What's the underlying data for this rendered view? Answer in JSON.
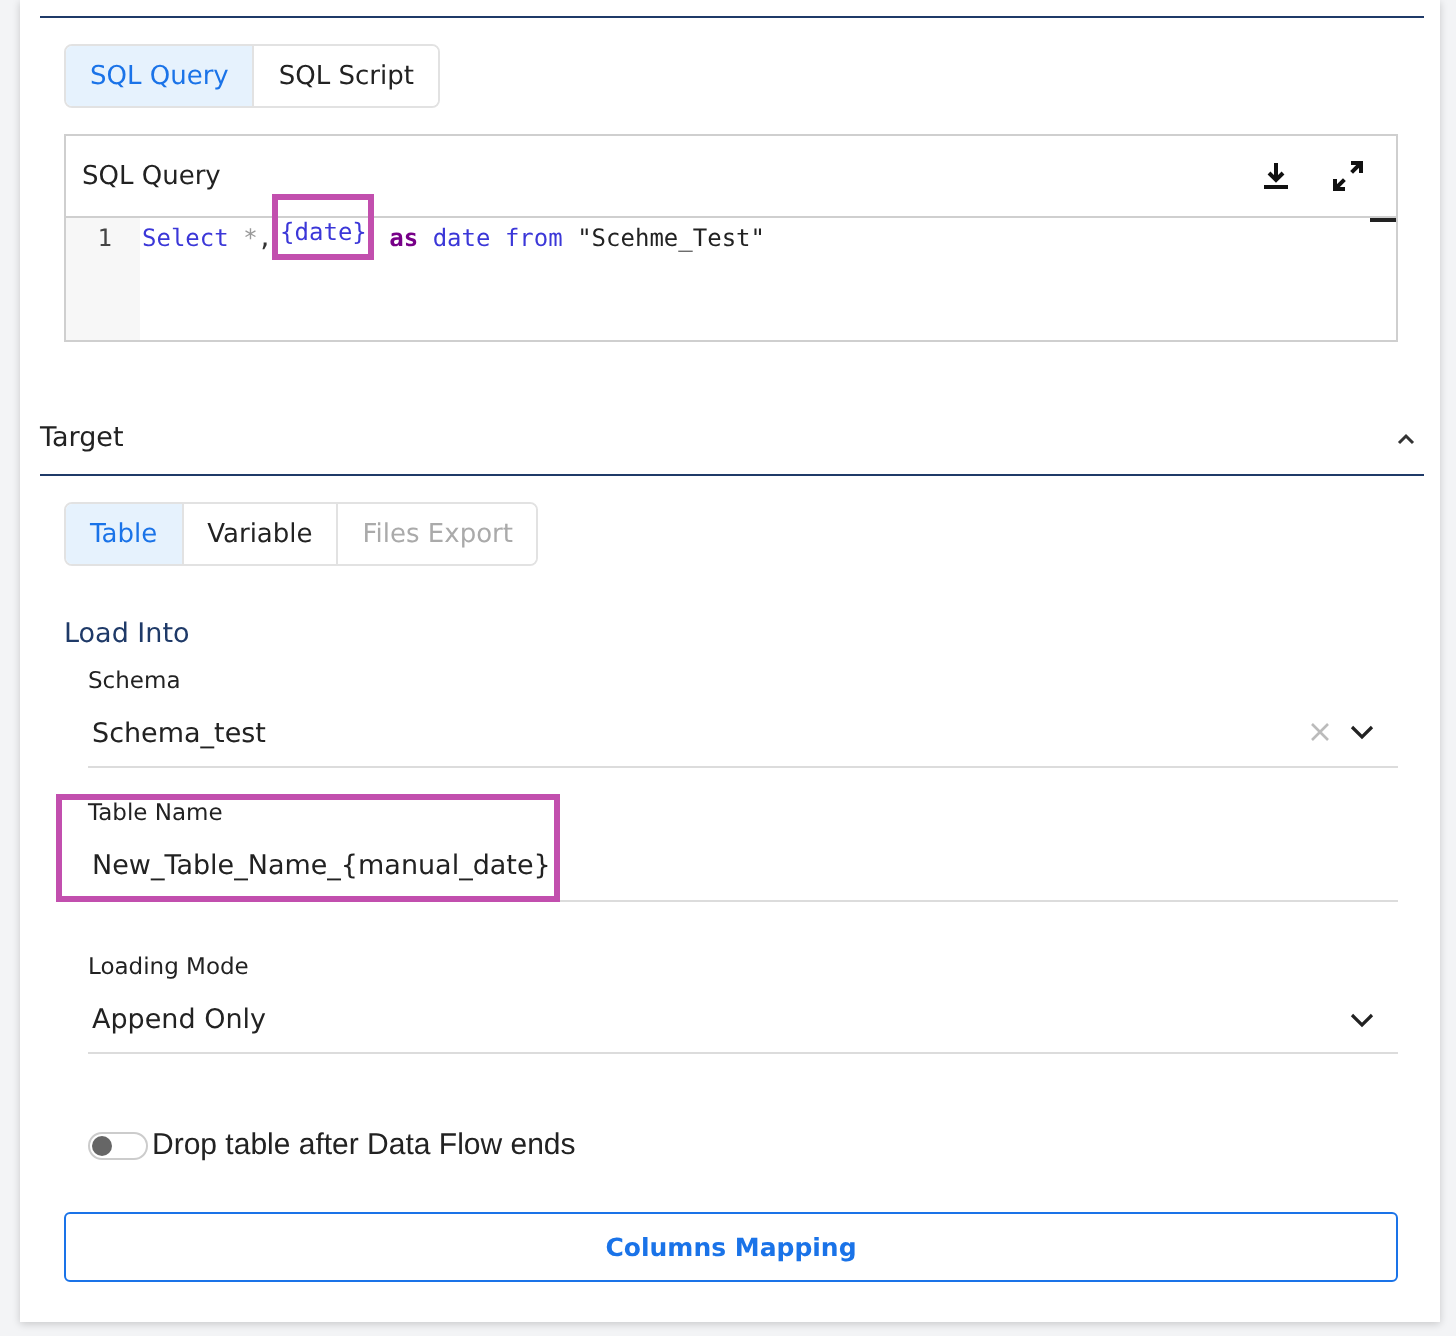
{
  "query_tabs": [
    {
      "label": "SQL Query",
      "selected": true
    },
    {
      "label": "SQL Script",
      "selected": false
    }
  ],
  "editor": {
    "title": "SQL Query",
    "lines": [
      {
        "number": "1",
        "tokens": [
          {
            "text": "Select",
            "kind": "keyword"
          },
          {
            "text": " *",
            "kind": "operator"
          },
          {
            "text": ",",
            "kind": "punct"
          },
          {
            "text": "{date}",
            "kind": "variable",
            "annotated": true
          },
          {
            "text": " as",
            "kind": "alias"
          },
          {
            "text": " date",
            "kind": "keyword"
          },
          {
            "text": " from",
            "kind": "keyword"
          },
          {
            "text": " \"Scehme_Test\"",
            "kind": "string"
          }
        ]
      }
    ]
  },
  "target": {
    "title": "Target",
    "expanded": true,
    "tabs": [
      {
        "label": "Table",
        "selected": true,
        "disabled": false
      },
      {
        "label": "Variable",
        "selected": false,
        "disabled": false
      },
      {
        "label": "Files Export",
        "selected": false,
        "disabled": true
      }
    ],
    "section_title": "Load Into",
    "fields": [
      {
        "kind": "select",
        "label": "Schema",
        "value": "Schema_test",
        "clearable": true,
        "annotated": false
      },
      {
        "kind": "text",
        "label": "Table Name",
        "value": "New_Table_Name_{manual_date}",
        "clearable": false,
        "annotated": true
      },
      {
        "kind": "select",
        "label": "Loading Mode",
        "value": "Append Only",
        "clearable": false,
        "annotated": false
      }
    ],
    "toggle": {
      "label": "Drop table after Data Flow ends",
      "on": false
    },
    "button": "Columns Mapping"
  }
}
